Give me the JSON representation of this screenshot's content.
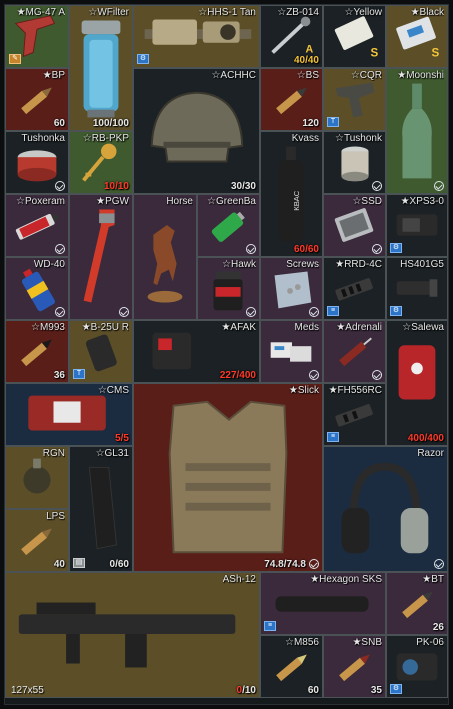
{
  "stash": {
    "items": [
      {
        "id": "mg47",
        "name": "★MG-47 A",
        "count": "",
        "bg": "olive",
        "icon": "pistol-grip-icon",
        "badge": "wrench",
        "check": false
      },
      {
        "id": "wfilter",
        "name": "☆WFilter",
        "count": "100/100",
        "bg": "olive",
        "icon": "water-filter-icon",
        "badge": "",
        "check": false
      },
      {
        "id": "hhs1",
        "name": "☆HHS-1 Tan",
        "count": "",
        "bg": "olive",
        "icon": "holographic-sight-icon",
        "badge": "gear",
        "check": false
      },
      {
        "id": "zb014",
        "name": "☆ZB-014",
        "count": "40/40",
        "countClass": "gold",
        "bg": "dark",
        "icon": "tool-icon",
        "badge": "",
        "check": false
      },
      {
        "id": "yellow",
        "name": "☆Yellow",
        "count": "",
        "bg": "dark",
        "icon": "yellow-keycard-icon",
        "badge": "",
        "check": false
      },
      {
        "id": "black",
        "name": "★Black",
        "count": "",
        "bg": "olive",
        "icon": "black-keycard-icon",
        "badge": "",
        "check": false
      },
      {
        "id": "bp",
        "name": "★BP",
        "count": "60",
        "bg": "red",
        "icon": "rifle-round-icon",
        "badge": "",
        "check": false
      },
      {
        "id": "achhc",
        "name": "☆ACHHC",
        "count": "30/30",
        "bg": "dark",
        "icon": "helmet-icon",
        "badge": "",
        "check": false
      },
      {
        "id": "bs",
        "name": "☆BS",
        "count": "120",
        "bg": "red",
        "icon": "rifle-round-icon",
        "badge": "",
        "check": false
      },
      {
        "id": "cqr",
        "name": "☆CQR",
        "count": "",
        "bg": "olive",
        "icon": "pistol-grip-icon",
        "badge": "T",
        "check": false
      },
      {
        "id": "moonshi",
        "name": "★Moonshi",
        "count": "",
        "bg": "green",
        "icon": "bottle-icon",
        "badge": "",
        "check": true
      },
      {
        "id": "tushonka",
        "name": "Tushonka",
        "count": "",
        "bg": "dark",
        "icon": "canned-food-icon",
        "badge": "",
        "check": true
      },
      {
        "id": "rbpkp",
        "name": "☆RB-PKP",
        "count": "10/10",
        "countClass": "red",
        "bg": "green",
        "icon": "key-icon",
        "badge": "",
        "check": false
      },
      {
        "id": "kvass",
        "name": "Kvass",
        "count": "60/60",
        "countClass": "red",
        "bg": "dark",
        "icon": "drink-bottle-icon",
        "badge": "",
        "check": false
      },
      {
        "id": "tushonk2",
        "name": "☆Tushonk",
        "count": "",
        "bg": "dark",
        "icon": "canned-food-icon",
        "badge": "",
        "check": true
      },
      {
        "id": "poxeram",
        "name": "☆Poxeram",
        "count": "",
        "bg": "purple",
        "icon": "glue-tube-icon",
        "badge": "",
        "check": true
      },
      {
        "id": "pgw",
        "name": "★PGW",
        "count": "",
        "bg": "purple",
        "icon": "pipe-wrench-icon",
        "badge": "",
        "check": true
      },
      {
        "id": "horse",
        "name": "Horse",
        "count": "",
        "bg": "purple",
        "icon": "horse-figurine-icon",
        "badge": "",
        "check": false
      },
      {
        "id": "greenba",
        "name": "☆GreenBa",
        "count": "",
        "bg": "purple",
        "icon": "battery-icon",
        "badge": "",
        "check": true
      },
      {
        "id": "ssd",
        "name": "☆SSD",
        "count": "",
        "bg": "purple",
        "icon": "ssd-drive-icon",
        "badge": "",
        "check": true
      },
      {
        "id": "xps30",
        "name": "★XPS3-0",
        "count": "",
        "bg": "dark",
        "icon": "holographic-sight-icon",
        "badge": "gear",
        "check": false
      },
      {
        "id": "wd40",
        "name": "WD-40",
        "count": "",
        "bg": "purple",
        "icon": "spray-can-icon",
        "badge": "",
        "check": true
      },
      {
        "id": "hawk",
        "name": "☆Hawk",
        "count": "",
        "bg": "purple",
        "icon": "powder-jar-icon",
        "badge": "",
        "check": true
      },
      {
        "id": "screws",
        "name": "Screws",
        "count": "",
        "bg": "purple",
        "icon": "screws-bag-icon",
        "badge": "",
        "check": true
      },
      {
        "id": "rrd4c",
        "name": "★RRD-4C",
        "count": "",
        "bg": "dark",
        "icon": "muzzle-brake-icon",
        "badge": "rail",
        "check": false
      },
      {
        "id": "hs401g5",
        "name": "HS401G5",
        "count": "",
        "bg": "dark",
        "icon": "flashlight-icon",
        "badge": "gear",
        "check": false
      },
      {
        "id": "m993",
        "name": "☆M993",
        "count": "36",
        "bg": "red",
        "icon": "rifle-round-icon",
        "badge": "",
        "check": false
      },
      {
        "id": "b25ur",
        "name": "★B-25U R",
        "count": "",
        "bg": "olive",
        "icon": "rail-cover-icon",
        "badge": "T",
        "check": false
      },
      {
        "id": "afak",
        "name": "★AFAK",
        "count": "227/400",
        "countClass": "red",
        "bg": "dark",
        "icon": "medkit-pouch-icon",
        "badge": "",
        "check": false
      },
      {
        "id": "meds",
        "name": "Meds",
        "count": "",
        "bg": "purple",
        "icon": "medicine-pack-icon",
        "badge": "",
        "check": true
      },
      {
        "id": "adrenali",
        "name": "★Adrenali",
        "count": "",
        "bg": "purple",
        "icon": "syringe-icon",
        "badge": "",
        "check": true
      },
      {
        "id": "salewa",
        "name": "☆Salewa",
        "count": "400/400",
        "countClass": "red",
        "bg": "dark",
        "icon": "first-aid-kit-icon",
        "badge": "",
        "check": false
      },
      {
        "id": "cms",
        "name": "☆CMS",
        "count": "5/5",
        "countClass": "red",
        "bg": "navy",
        "icon": "surgical-kit-icon",
        "badge": "",
        "check": false
      },
      {
        "id": "slick",
        "name": "★Slick",
        "count": "74.8/74.8",
        "bg": "red",
        "icon": "plate-carrier-icon",
        "badge": "",
        "check": true
      },
      {
        "id": "fh556rc",
        "name": "★FH556RC",
        "count": "",
        "bg": "dark",
        "icon": "muzzle-brake-icon",
        "badge": "rail",
        "check": false
      },
      {
        "id": "rgn",
        "name": "RGN",
        "count": "",
        "bg": "olive",
        "icon": "grenade-icon",
        "badge": "",
        "check": false
      },
      {
        "id": "gl31",
        "name": "☆GL31",
        "count": "0/60",
        "bg": "dark",
        "icon": "magazine-icon",
        "badge": "doc",
        "check": false
      },
      {
        "id": "razor",
        "name": "Razor",
        "count": "",
        "bg": "navy",
        "icon": "headset-icon",
        "badge": "",
        "check": true
      },
      {
        "id": "lps",
        "name": "LPS",
        "count": "40",
        "bg": "olive",
        "icon": "rifle-round-icon",
        "badge": "",
        "check": false
      },
      {
        "id": "ash12",
        "name": "ASh-12",
        "count": "",
        "dims": "127x55",
        "ammoCur": "0",
        "ammoMax": "/10",
        "bg": "olive",
        "icon": "assault-rifle-icon",
        "badge": "",
        "check": false
      },
      {
        "id": "hexsks",
        "name": "★Hexagon SKS",
        "count": "",
        "bg": "purple",
        "icon": "suppressor-icon",
        "badge": "rail",
        "check": false
      },
      {
        "id": "bt",
        "name": "★BT",
        "count": "26",
        "bg": "purple",
        "icon": "rifle-round-icon",
        "badge": "",
        "check": false
      },
      {
        "id": "m856",
        "name": "☆M856",
        "count": "60",
        "bg": "dark",
        "icon": "rifle-round-icon",
        "badge": "",
        "check": false
      },
      {
        "id": "snb",
        "name": "★SNB",
        "count": "35",
        "bg": "purple",
        "icon": "rifle-round-icon",
        "badge": "",
        "check": false
      },
      {
        "id": "pk06",
        "name": "PK-06",
        "count": "",
        "bg": "dark",
        "icon": "collimator-sight-icon",
        "badge": "gear",
        "check": false
      }
    ]
  }
}
